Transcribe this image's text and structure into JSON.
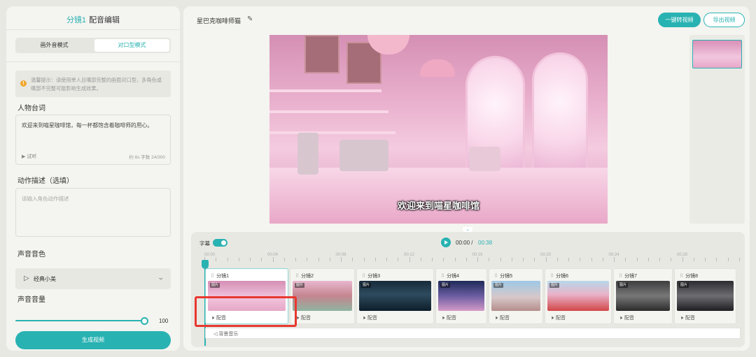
{
  "left_panel": {
    "title_accent": "分镜1",
    "title_rest": "配音编辑",
    "tabs": [
      "画外音模式",
      "对口型模式"
    ],
    "active_tab": 1,
    "tip": "温馨提示：请使用单人且嘴部完整的画面对口型，多角色或嘴部不完整可能影响生成效果。",
    "dialogue_label": "人物台词",
    "dialogue_value": "欢迎来到喵星咖啡馆，每一杯都饱含着咖啡师的用心。",
    "listen_label": "▶ 试听",
    "dialogue_stats": "约 6s 字数 24/300",
    "action_label": "动作描述（选填）",
    "action_placeholder": "请输入角色动作描述",
    "voice_label": "声音音色",
    "voice_value": "经典小美",
    "volume_label": "声音音量",
    "volume_value": "100",
    "generate_button": "生成视频"
  },
  "right_panel": {
    "project_title": "星巴克咖啡师猫",
    "convert_button": "一键转视频",
    "export_button": "导出视频",
    "subtitle_text": "欢迎来到喵星咖啡馆"
  },
  "timeline": {
    "subtitle_toggle_label": "字幕",
    "subtitle_toggle_on": true,
    "current_time": "00:00",
    "separator": "/",
    "total_time": "00:38",
    "ruler_labels": [
      "00:00",
      "00:04",
      "00:08",
      "00:12",
      "00:16",
      "00:20",
      "00:24",
      "00:28"
    ],
    "image_badge": "图片",
    "clips": [
      {
        "label": "分镜1",
        "audio": "配音",
        "selected": true
      },
      {
        "label": "分镜2",
        "audio": "配音",
        "selected": false
      },
      {
        "label": "分镜3",
        "audio": "配音",
        "selected": false
      },
      {
        "label": "分镜4",
        "audio": "配音",
        "selected": false
      },
      {
        "label": "分镜5",
        "audio": "配音",
        "selected": false
      },
      {
        "label": "分镜6",
        "audio": "配音",
        "selected": false
      },
      {
        "label": "分镜7",
        "audio": "配音",
        "selected": false
      },
      {
        "label": "分镜8",
        "audio": "配音",
        "selected": false
      }
    ],
    "bgm_label": "背景音乐"
  },
  "colors": {
    "accent": "#29b2b2",
    "highlight": "#e8382f"
  }
}
